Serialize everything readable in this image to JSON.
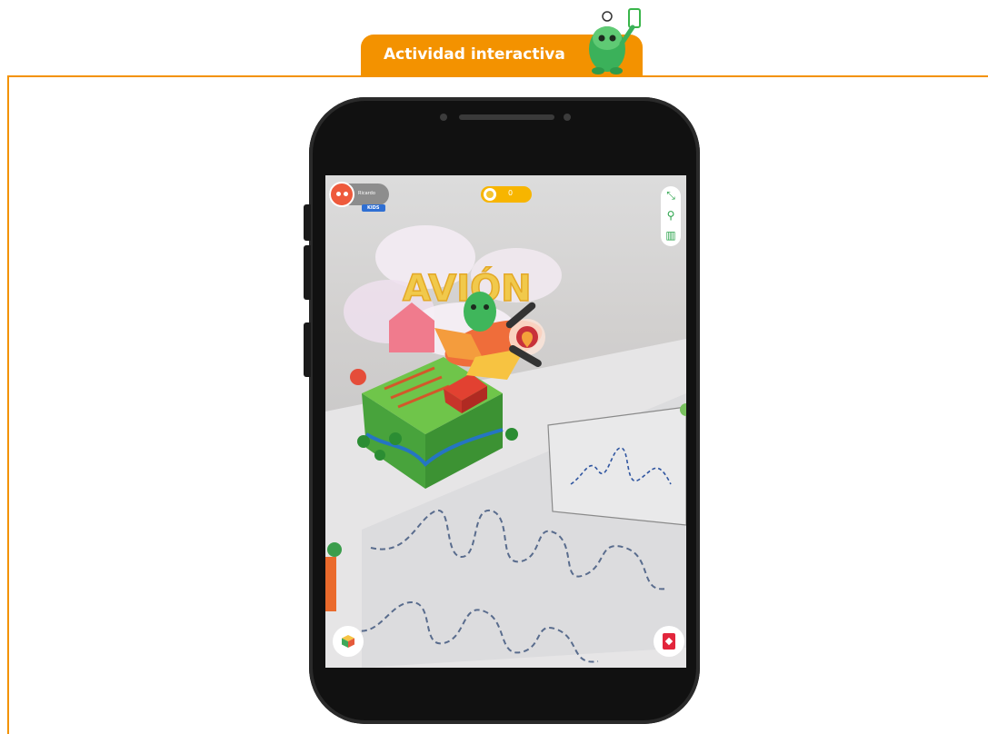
{
  "header": {
    "title": "Actividad interactiva",
    "accent_color": "#f39200",
    "mascot_icon": "green-monster-with-phone-icon"
  },
  "app": {
    "user": {
      "name": "Ricardo",
      "badge": "KIDS"
    },
    "coins": {
      "count": "0"
    },
    "tools": [
      "expand-icon",
      "search-icon",
      "book-icon"
    ],
    "scene_word": "AVIÓN",
    "bottom_left_icon": "cube-icon",
    "bottom_right_icon": "card-icon"
  }
}
